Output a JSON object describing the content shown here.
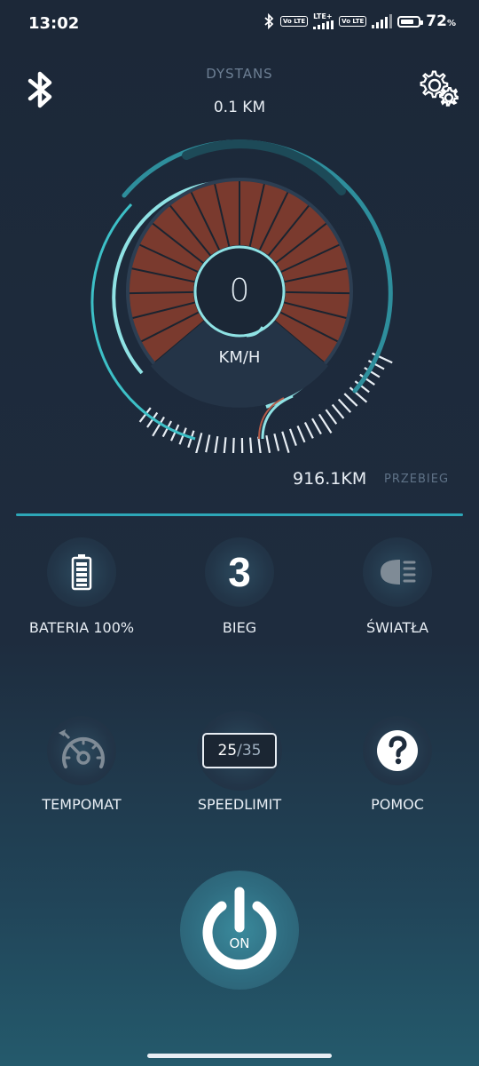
{
  "status_bar": {
    "time": "13:02",
    "volte_1": "Vo LTE",
    "lte_label": "LTE+",
    "volte_2": "Vo LTE",
    "battery_percent": "72",
    "battery_suffix": "%"
  },
  "header": {
    "distance_label": "DYSTANS",
    "distance_value": "0.1 KM",
    "left_icon": "bluetooth-icon",
    "right_icon": "settings-icon"
  },
  "speedometer": {
    "speed": "0",
    "unit": "KM/H"
  },
  "odometer": {
    "value": "916.1KM",
    "label": "PRZEBIEG"
  },
  "tiles": {
    "battery": {
      "label": "BATERIA 100%",
      "icon": "battery-icon"
    },
    "gear": {
      "value": "3",
      "label": "BIEG"
    },
    "lights": {
      "label": "ŚWIATŁA",
      "icon": "headlight-icon"
    },
    "cruise": {
      "label": "TEMPOMAT",
      "icon": "speedometer-icon"
    },
    "speedlimit": {
      "label": "SPEEDLIMIT",
      "current": "25",
      "separator": "/",
      "max": "35"
    },
    "help": {
      "label": "POMOC",
      "icon": "help-icon"
    }
  },
  "power": {
    "label": "ON"
  },
  "colors": {
    "accent": "#2da7b8",
    "gauge_fill": "#7a3a2e",
    "background": "#1c2838"
  }
}
